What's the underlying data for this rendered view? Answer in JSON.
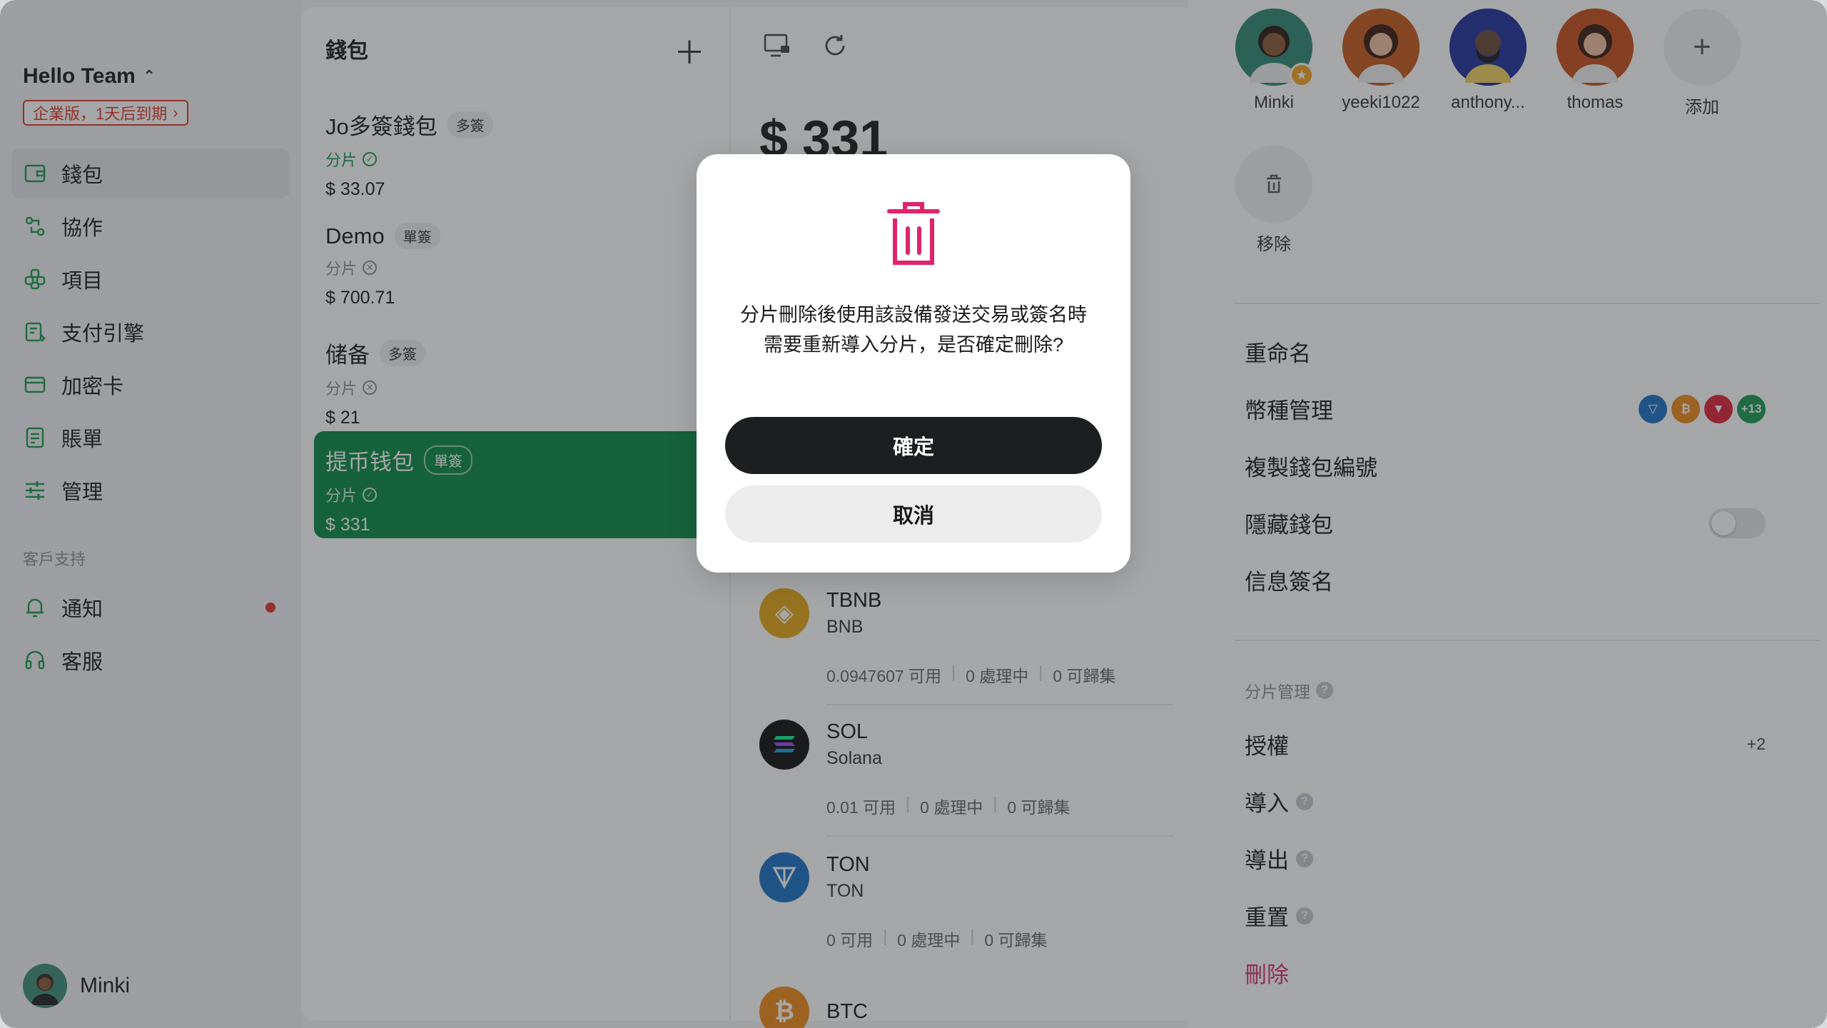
{
  "sidebar": {
    "team_name": "Hello Team",
    "plan_badge": "企業版，1天后到期",
    "nav": [
      {
        "label": "錢包",
        "icon": "wallet-icon"
      },
      {
        "label": "協作",
        "icon": "collab-icon"
      },
      {
        "label": "項目",
        "icon": "project-icon"
      },
      {
        "label": "支付引擎",
        "icon": "payment-engine-icon"
      },
      {
        "label": "加密卡",
        "icon": "card-icon"
      },
      {
        "label": "賬單",
        "icon": "bill-icon"
      },
      {
        "label": "管理",
        "icon": "settings-sliders-icon"
      }
    ],
    "support_section": "客戶支持",
    "support": [
      {
        "label": "通知",
        "icon": "bell-icon"
      },
      {
        "label": "客服",
        "icon": "headset-icon"
      }
    ],
    "user_name": "Minki"
  },
  "wallets": {
    "header": "錢包",
    "items": [
      {
        "name": "Jo多簽錢包",
        "tag": "多簽",
        "sub": "分片",
        "balance": "$ 33.07"
      },
      {
        "name": "Demo",
        "tag": "單簽",
        "sub": "分片",
        "balance": "$ 700.71"
      },
      {
        "name": "储备",
        "tag": "多簽",
        "sub": "分片",
        "balance": "$ 21"
      },
      {
        "name": "提币钱包",
        "tag": "單簽",
        "sub": "分片",
        "balance": "$ 331"
      }
    ]
  },
  "detail": {
    "balance": "$ 331",
    "assets": [
      {
        "symbol": "TBNB",
        "chain": "BNB",
        "available": "0.0947607 可用",
        "processing": "0 處理中",
        "collectable": "0 可歸集",
        "color": "#e6a817"
      },
      {
        "symbol": "SOL",
        "chain": "Solana",
        "available": "0.01 可用",
        "processing": "0 處理中",
        "collectable": "0 可歸集",
        "color": "#111111"
      },
      {
        "symbol": "TON",
        "chain": "TON",
        "available": "0 可用",
        "processing": "0 處理中",
        "collectable": "0 可歸集",
        "color": "#1a73c9"
      },
      {
        "symbol": "BTC",
        "chain": "",
        "available": "",
        "processing": "",
        "collectable": "",
        "color": "#f08a1a"
      }
    ]
  },
  "right": {
    "members": [
      {
        "name": "Minki",
        "color": "#2f8a72"
      },
      {
        "name": "yeeki1022",
        "color": "#c85a1e"
      },
      {
        "name": "anthony...",
        "color": "#2232a0"
      },
      {
        "name": "thomas",
        "color": "#c8501e"
      }
    ],
    "add_label": "添加",
    "remove_label": "移除",
    "menu": {
      "rename": "重命名",
      "currency_manage": "幣種管理",
      "currency_extra": "+13",
      "copy_id": "複製錢包編號",
      "hide_wallet": "隱藏錢包",
      "sign_message": "信息簽名"
    },
    "shard_section": "分片管理",
    "shard": {
      "authorize": "授權",
      "authorize_extra": "+2",
      "import": "導入",
      "export": "導出",
      "reset": "重置",
      "delete": "刪除"
    }
  },
  "modal": {
    "message_line1": "分片刪除後使用該設備發送交易或簽名時",
    "message_line2": "需要重新導入分片，是否確定刪除?",
    "confirm": "確定",
    "cancel": "取消",
    "accent": "#e0246b"
  }
}
